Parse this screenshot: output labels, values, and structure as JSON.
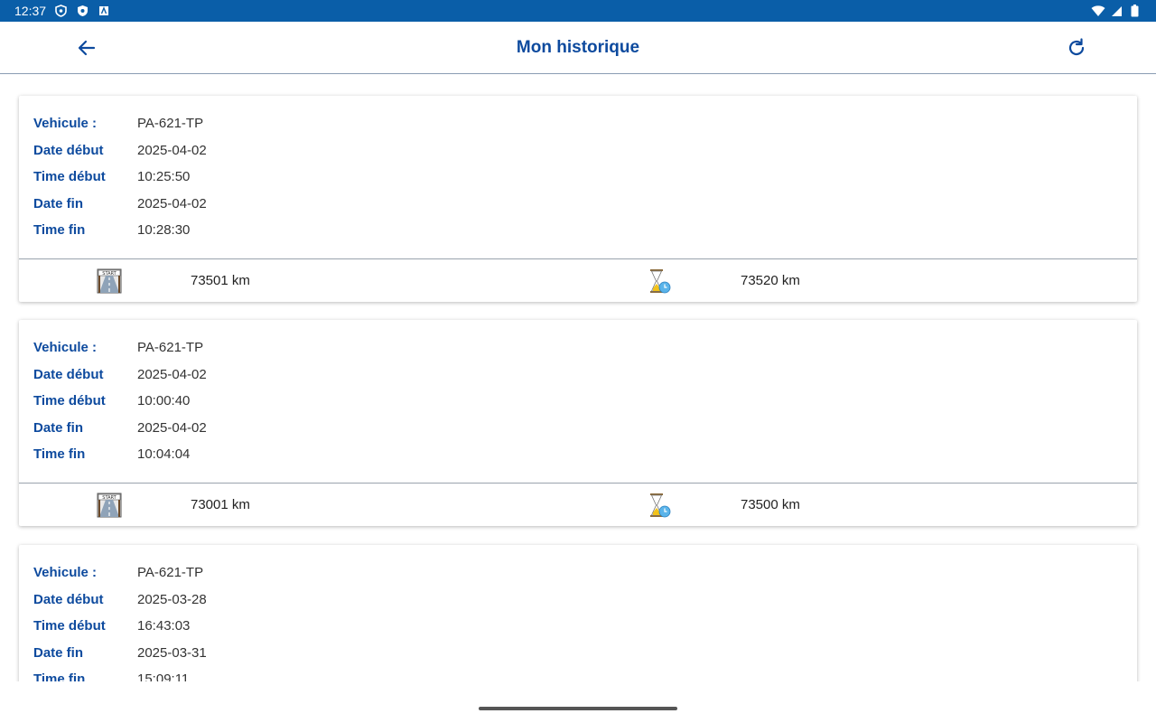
{
  "status_bar": {
    "time": "12:37"
  },
  "app_bar": {
    "title": "Mon historique"
  },
  "labels": {
    "vehicule": "Vehicule :",
    "date_debut": "Date début",
    "time_debut": "Time début",
    "date_fin": "Date fin",
    "time_fin": "Time fin"
  },
  "entries": [
    {
      "vehicule": "PA-621-TP",
      "date_debut": "2025-04-02",
      "time_debut": "10:25:50",
      "date_fin": "2025-04-02",
      "time_fin": "10:28:30",
      "km_start": "73501 km",
      "km_end": "73520 km"
    },
    {
      "vehicule": "PA-621-TP",
      "date_debut": "2025-04-02",
      "time_debut": "10:00:40",
      "date_fin": "2025-04-02",
      "time_fin": "10:04:04",
      "km_start": "73001 km",
      "km_end": "73500 km"
    },
    {
      "vehicule": "PA-621-TP",
      "date_debut": "2025-03-28",
      "time_debut": "16:43:03",
      "date_fin": "2025-03-31",
      "time_fin": "15:09:11"
    }
  ],
  "icons": {
    "back": "arrow-back-icon",
    "refresh": "refresh-icon",
    "start": "start-road-icon",
    "end": "hourglass-clock-icon"
  },
  "colors": {
    "status_bar": "#0a5ea8",
    "accent": "#0d4a9e"
  }
}
